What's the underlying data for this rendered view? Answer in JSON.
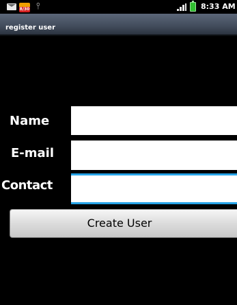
{
  "status_bar": {
    "time": "8:33 AM",
    "calendar_badge": "8/30",
    "icons": [
      "mail-icon",
      "calendar-icon",
      "usb-icon",
      "signal-icon",
      "battery-icon"
    ]
  },
  "app": {
    "title": "register user"
  },
  "form": {
    "name_label": "Name",
    "email_label": "E-mail",
    "contact_label": "Contact",
    "name_value": "",
    "email_value": "",
    "contact_value": "",
    "focused_field": "contact"
  },
  "actions": {
    "create_label": "Create User"
  },
  "colors": {
    "background": "#000000",
    "title_bar": "#424c5c",
    "focus_accent": "#27a4e8",
    "button_bg": "#dcdcdc",
    "battery": "#2fbf2f"
  }
}
